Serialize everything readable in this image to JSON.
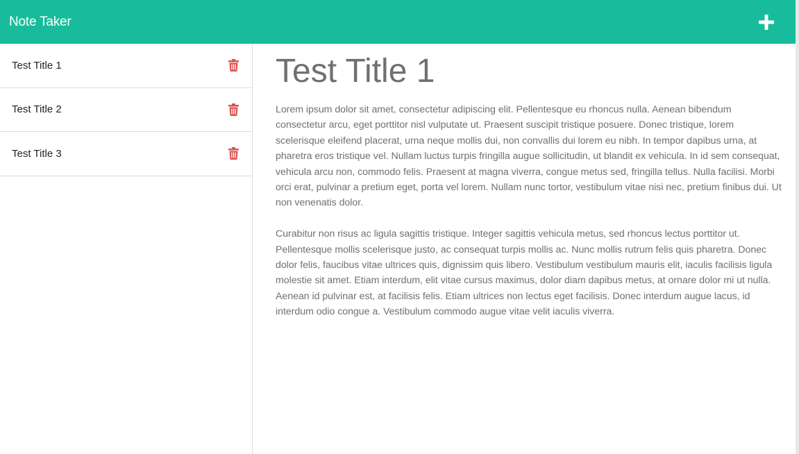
{
  "app": {
    "brand": "Note Taker"
  },
  "colors": {
    "navbar": "#18bc9c",
    "delete": "#d9534f",
    "text": "#707070"
  },
  "icons": {
    "new_note": "plus-icon",
    "delete": "trash-icon"
  },
  "notes": [
    {
      "title": "Test Title 1"
    },
    {
      "title": "Test Title 2"
    },
    {
      "title": "Test Title 3"
    }
  ],
  "active_note": {
    "title": "Test Title 1",
    "paragraphs": [
      "Lorem ipsum dolor sit amet, consectetur adipiscing elit. Pellentesque eu rhoncus nulla. Aenean bibendum consectetur arcu, eget porttitor nisl vulputate ut. Praesent suscipit tristique posuere. Donec tristique, lorem scelerisque eleifend placerat, urna neque mollis dui, non convallis dui lorem eu nibh. In tempor dapibus urna, at pharetra eros tristique vel. Nullam luctus turpis fringilla augue sollicitudin, ut blandit ex vehicula. In id sem consequat, vehicula arcu non, commodo felis. Praesent at magna viverra, congue metus sed, fringilla tellus. Nulla facilisi. Morbi orci erat, pulvinar a pretium eget, porta vel lorem. Nullam nunc tortor, vestibulum vitae nisi nec, pretium finibus dui. Ut non venenatis dolor.",
      "Curabitur non risus ac ligula sagittis tristique. Integer sagittis vehicula metus, sed rhoncus lectus porttitor ut. Pellentesque mollis scelerisque justo, ac consequat turpis mollis ac. Nunc mollis rutrum felis quis pharetra. Donec dolor felis, faucibus vitae ultrices quis, dignissim quis libero. Vestibulum vestibulum mauris elit, iaculis facilisis ligula molestie sit amet. Etiam interdum, elit vitae cursus maximus, dolor diam dapibus metus, at ornare dolor mi ut nulla. Aenean id pulvinar est, at facilisis felis. Etiam ultrices non lectus eget facilisis. Donec interdum augue lacus, id interdum odio congue a. Vestibulum commodo augue vitae velit iaculis viverra."
    ]
  }
}
